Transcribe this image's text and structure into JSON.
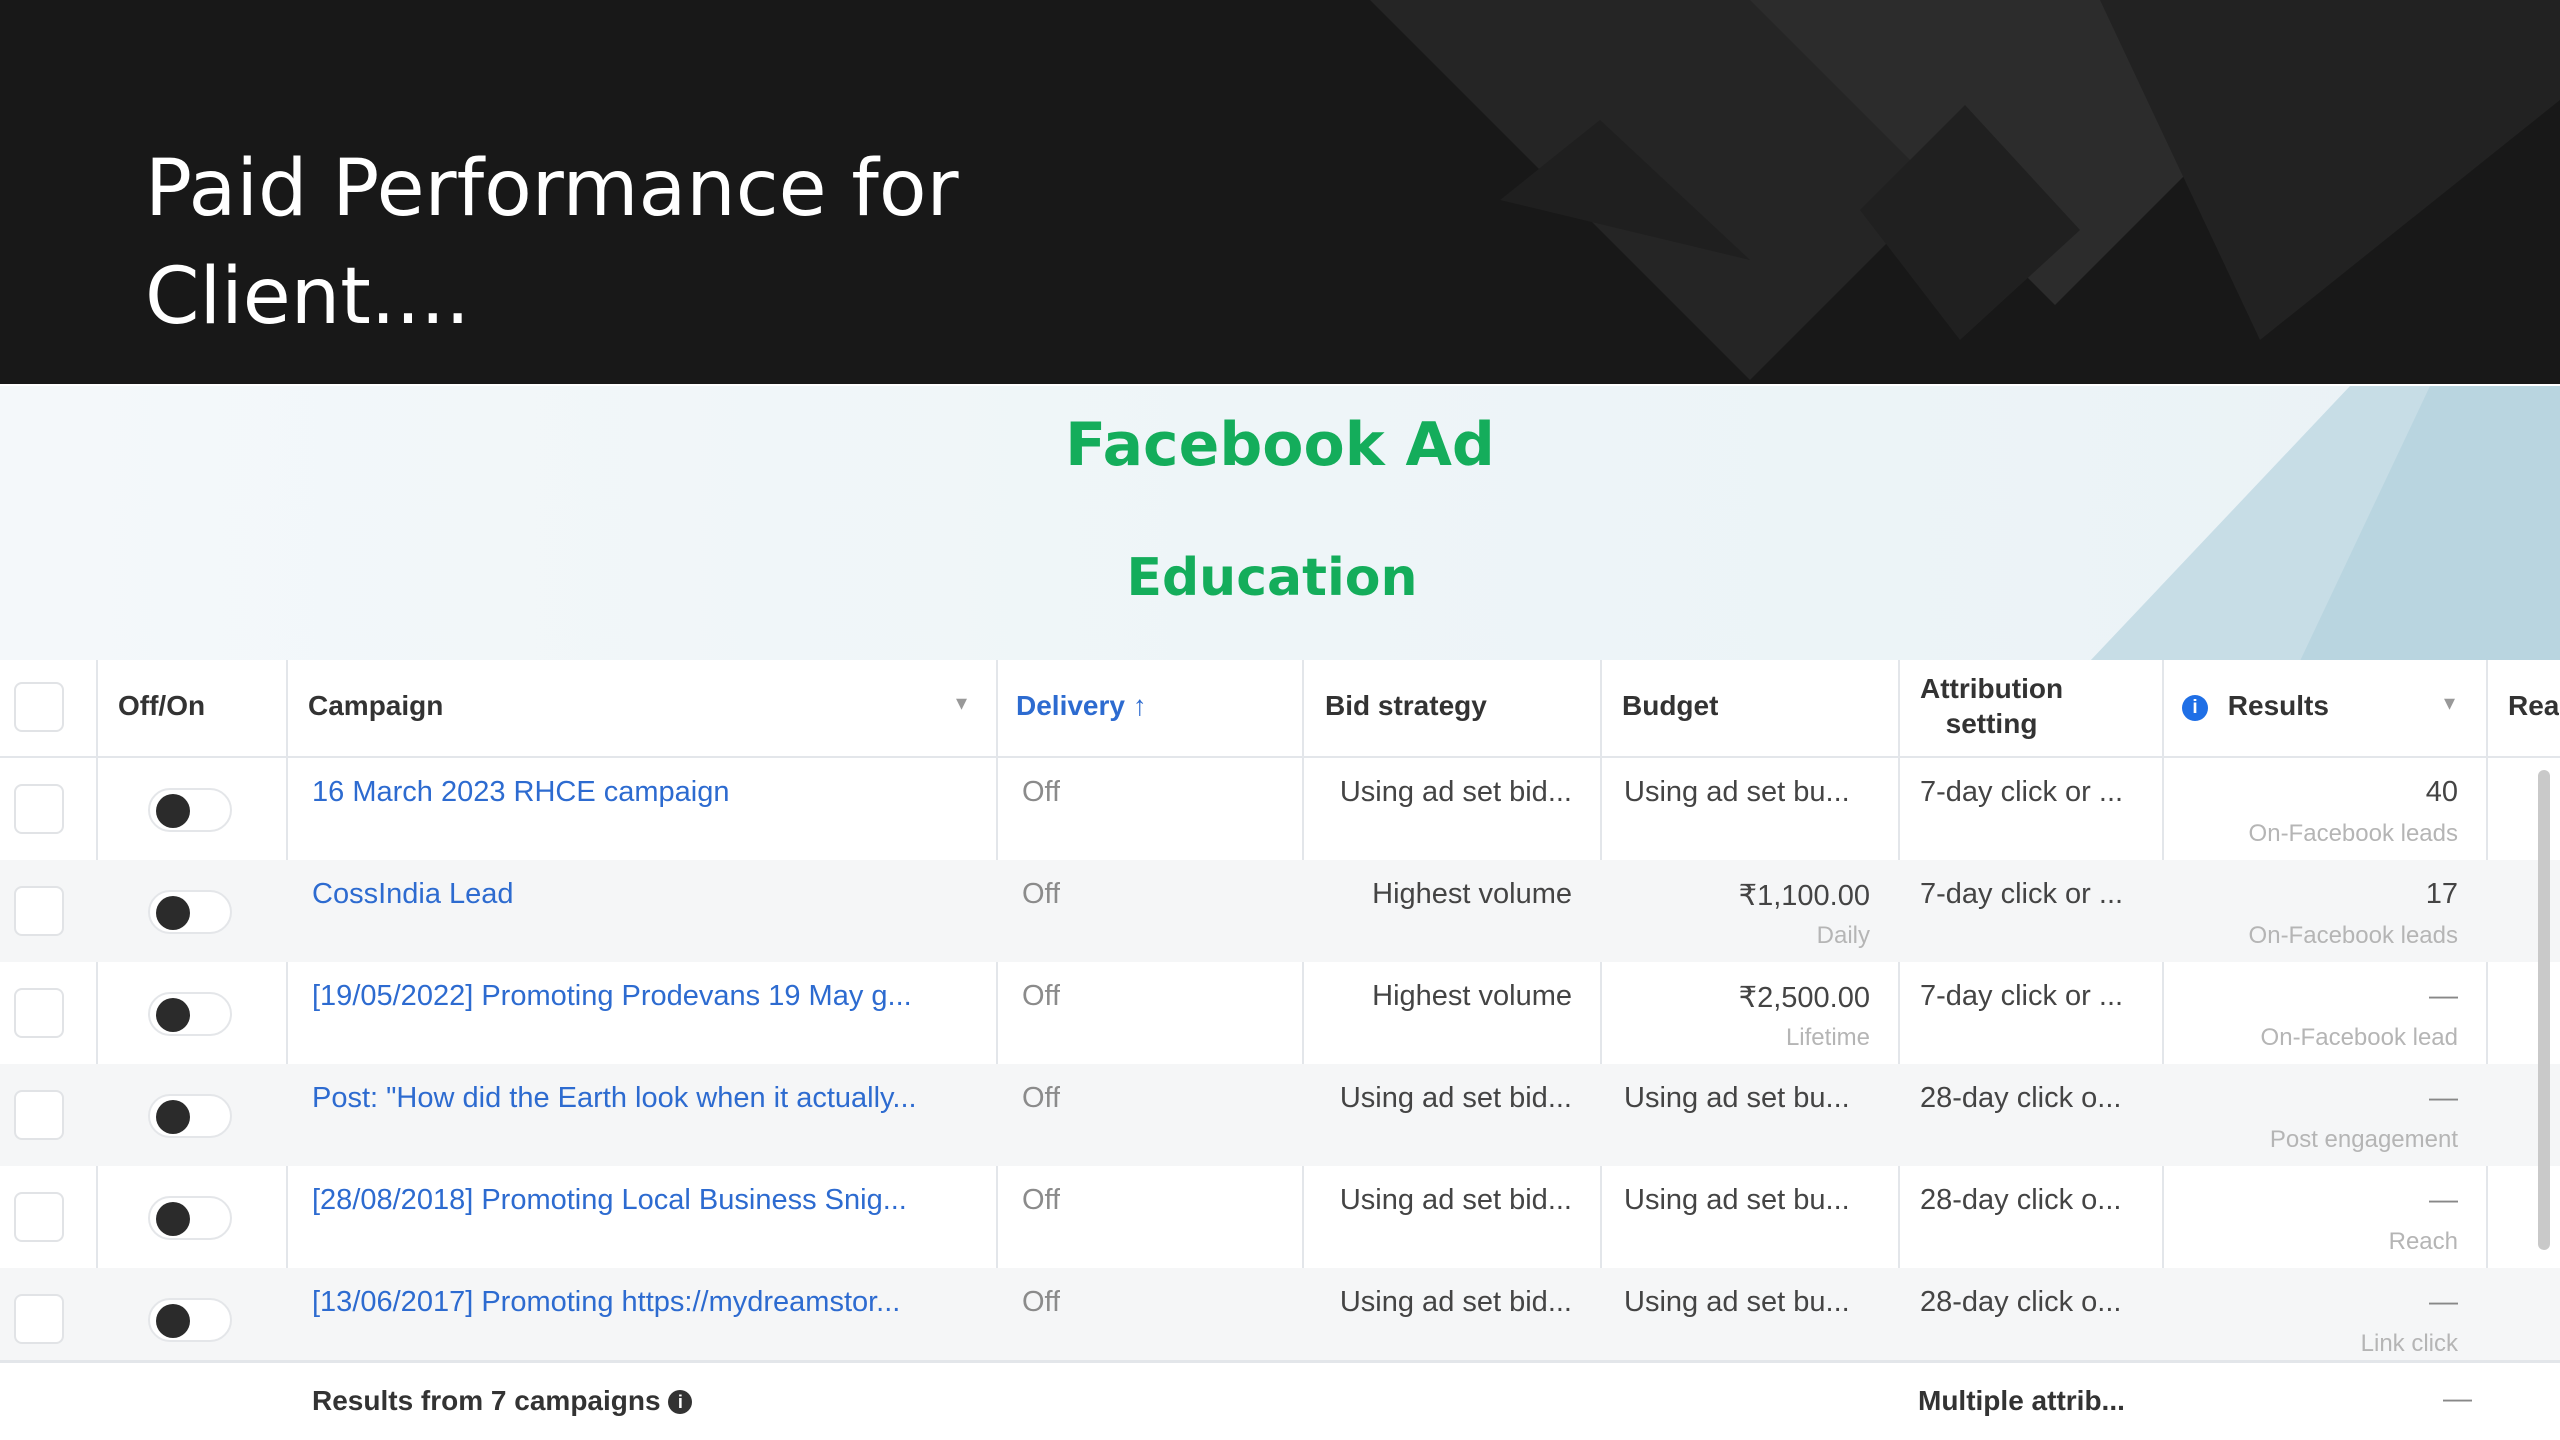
{
  "header": {
    "title": "Paid Performance for\nClient...."
  },
  "section": {
    "title": "Facebook Ad",
    "subtitle": "Education"
  },
  "table": {
    "columns": {
      "offon": "Off/On",
      "campaign": "Campaign",
      "delivery": "Delivery",
      "bid": "Bid strategy",
      "budget": "Budget",
      "attribution": "Attribution\nsetting",
      "results": "Results",
      "reach": "Rea"
    },
    "rows": [
      {
        "campaign": "16 March 2023 RHCE campaign",
        "delivery": "Off",
        "bid": "Using ad set bid...",
        "budget": "Using ad set bu...",
        "budget_sub": "",
        "attribution": "7-day click or ...",
        "results": "40",
        "results_sub": "On-Facebook leads"
      },
      {
        "campaign": "CossIndia Lead",
        "delivery": "Off",
        "bid": "Highest volume",
        "budget": "₹1,100.00",
        "budget_sub": "Daily",
        "attribution": "7-day click or ...",
        "results": "17",
        "results_sub": "On-Facebook leads"
      },
      {
        "campaign": "[19/05/2022] Promoting Prodevans 19 May g...",
        "delivery": "Off",
        "bid": "Highest volume",
        "budget": "₹2,500.00",
        "budget_sub": "Lifetime",
        "attribution": "7-day click or ...",
        "results": "—",
        "results_sub": "On-Facebook lead"
      },
      {
        "campaign": "Post: \"How did the Earth look when it actually...",
        "delivery": "Off",
        "bid": "Using ad set bid...",
        "budget": "Using ad set bu...",
        "budget_sub": "",
        "attribution": "28-day click o...",
        "results": "—",
        "results_sub": "Post engagement"
      },
      {
        "campaign": "[28/08/2018] Promoting Local Business Snig...",
        "delivery": "Off",
        "bid": "Using ad set bid...",
        "budget": "Using ad set bu...",
        "budget_sub": "",
        "attribution": "28-day click o...",
        "results": "—",
        "results_sub": "Reach"
      },
      {
        "campaign": "[13/06/2017] Promoting https://mydreamstor...",
        "delivery": "Off",
        "bid": "Using ad set bid...",
        "budget": "Using ad set bu...",
        "budget_sub": "",
        "attribution": "28-day click o...",
        "results": "—",
        "results_sub": "Link click"
      }
    ],
    "footer": {
      "label": "Results from 7 campaigns",
      "attribution": "Multiple attrib...",
      "results": "—"
    }
  },
  "icons": {
    "sort": "sort-up-arrow-icon",
    "info": "info-icon",
    "dropdown": "dropdown-caret-icon"
  },
  "colors": {
    "accent": "#14ad5b",
    "link": "#2d6bd0",
    "header_bg": "#181818"
  }
}
